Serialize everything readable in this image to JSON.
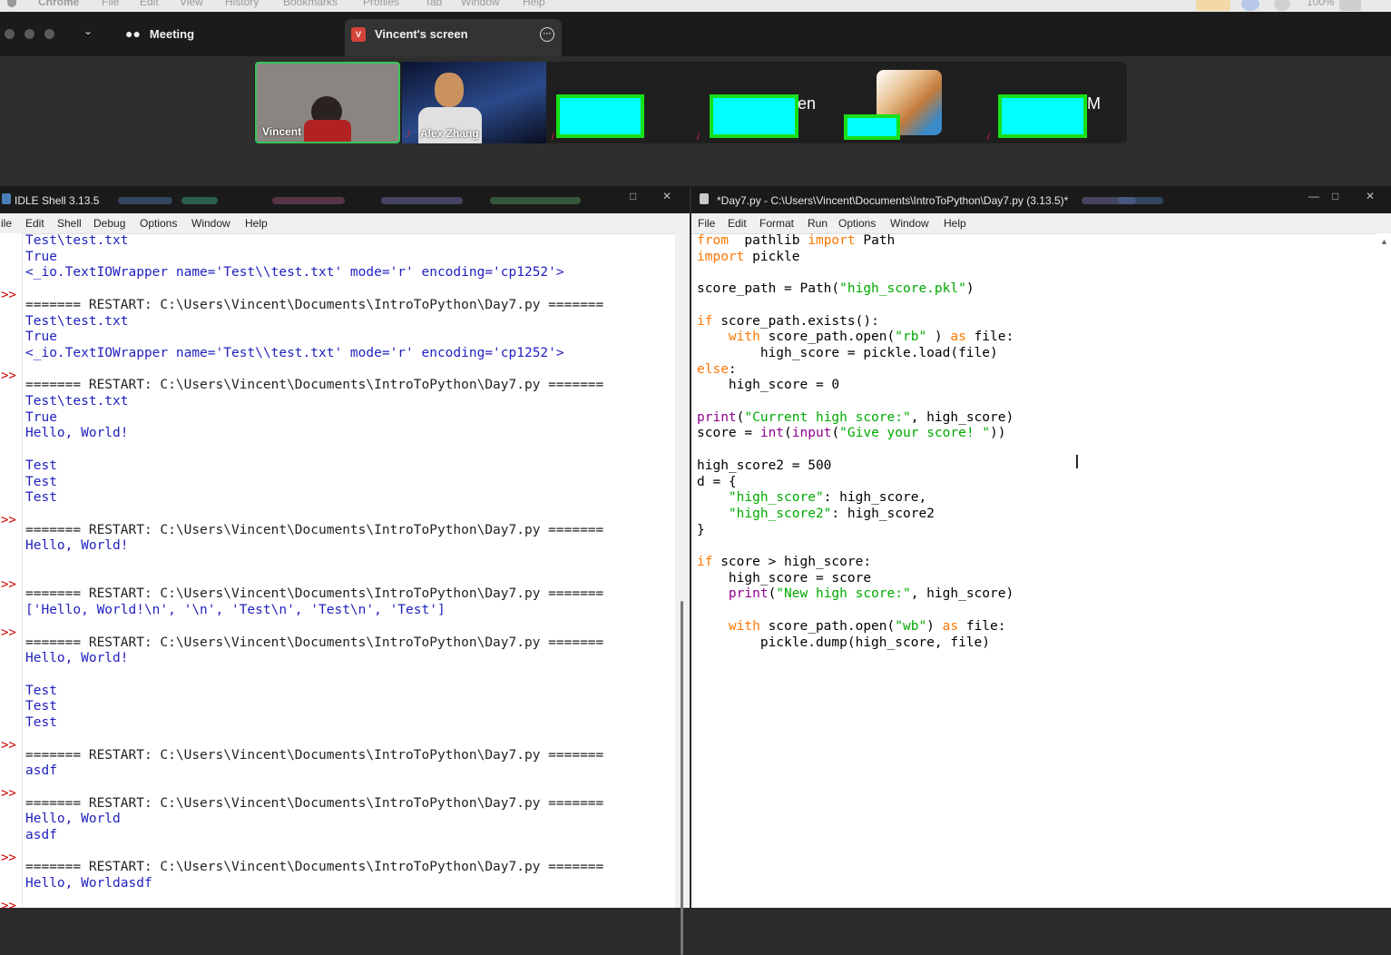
{
  "mac_menu": {
    "app": "Chrome",
    "items": [
      "File",
      "Edit",
      "View",
      "History",
      "Bookmarks",
      "Profiles",
      "Tab",
      "Window",
      "Help"
    ],
    "battery": "100%"
  },
  "zoom": {
    "meeting_label": "Meeting",
    "screen_tab_label": "Vincent's screen",
    "screen_tab_badge": "V",
    "participants": [
      {
        "name": "Vincent"
      },
      {
        "name": "Alex Zhang"
      }
    ],
    "name_fragments": [
      "en",
      "M"
    ]
  },
  "shell": {
    "title": "IDLE Shell 3.13.5",
    "menu": [
      "ile",
      "Edit",
      "Shell",
      "Debug",
      "Options",
      "Window",
      "Help"
    ],
    "lines": [
      {
        "t": "Test\\test.txt",
        "c": "out"
      },
      {
        "t": "True",
        "c": "out"
      },
      {
        "t": "<_io.TextIOWrapper name='Test\\\\test.txt' mode='r' encoding='cp1252'>",
        "c": "out"
      },
      {
        "t": "",
        "c": "sys",
        "p": ">>"
      },
      {
        "t": "======= RESTART: C:\\Users\\Vincent\\Documents\\IntroToPython\\Day7.py =======",
        "c": "sys"
      },
      {
        "t": "Test\\test.txt",
        "c": "out"
      },
      {
        "t": "True",
        "c": "out"
      },
      {
        "t": "<_io.TextIOWrapper name='Test\\\\test.txt' mode='r' encoding='cp1252'>",
        "c": "out"
      },
      {
        "t": "",
        "c": "sys",
        "p": ">>"
      },
      {
        "t": "======= RESTART: C:\\Users\\Vincent\\Documents\\IntroToPython\\Day7.py =======",
        "c": "sys"
      },
      {
        "t": "Test\\test.txt",
        "c": "out"
      },
      {
        "t": "True",
        "c": "out"
      },
      {
        "t": "Hello, World!",
        "c": "out"
      },
      {
        "t": "",
        "c": "out"
      },
      {
        "t": "Test",
        "c": "out"
      },
      {
        "t": "Test",
        "c": "out"
      },
      {
        "t": "Test",
        "c": "out"
      },
      {
        "t": "",
        "c": "sys",
        "p": ">>"
      },
      {
        "t": "======= RESTART: C:\\Users\\Vincent\\Documents\\IntroToPython\\Day7.py =======",
        "c": "sys"
      },
      {
        "t": "Hello, World!",
        "c": "out"
      },
      {
        "t": "",
        "c": "out"
      },
      {
        "t": "",
        "c": "sys",
        "p": ">>"
      },
      {
        "t": "======= RESTART: C:\\Users\\Vincent\\Documents\\IntroToPython\\Day7.py =======",
        "c": "sys"
      },
      {
        "t": "['Hello, World!\\n', '\\n', 'Test\\n', 'Test\\n', 'Test']",
        "c": "out"
      },
      {
        "t": "",
        "c": "sys",
        "p": ">>"
      },
      {
        "t": "======= RESTART: C:\\Users\\Vincent\\Documents\\IntroToPython\\Day7.py =======",
        "c": "sys"
      },
      {
        "t": "Hello, World!",
        "c": "out"
      },
      {
        "t": "",
        "c": "out"
      },
      {
        "t": "Test",
        "c": "out"
      },
      {
        "t": "Test",
        "c": "out"
      },
      {
        "t": "Test",
        "c": "out"
      },
      {
        "t": "",
        "c": "sys",
        "p": ">>"
      },
      {
        "t": "======= RESTART: C:\\Users\\Vincent\\Documents\\IntroToPython\\Day7.py =======",
        "c": "sys"
      },
      {
        "t": "asdf",
        "c": "out"
      },
      {
        "t": "",
        "c": "sys",
        "p": ">>"
      },
      {
        "t": "======= RESTART: C:\\Users\\Vincent\\Documents\\IntroToPython\\Day7.py =======",
        "c": "sys"
      },
      {
        "t": "Hello, World",
        "c": "out"
      },
      {
        "t": "asdf",
        "c": "out"
      },
      {
        "t": "",
        "c": "sys",
        "p": ">>"
      },
      {
        "t": "======= RESTART: C:\\Users\\Vincent\\Documents\\IntroToPython\\Day7.py =======",
        "c": "sys"
      },
      {
        "t": "Hello, Worldasdf",
        "c": "out"
      },
      {
        "t": "",
        "c": "sys",
        "p": ">>"
      }
    ]
  },
  "editor": {
    "title": "*Day7.py - C:\\Users\\Vincent\\Documents\\IntroToPython\\Day7.py (3.13.5)*",
    "menu": [
      "File",
      "Edit",
      "Format",
      "Run",
      "Options",
      "Window",
      "Help"
    ],
    "code": [
      [
        [
          "kw",
          "from"
        ],
        [
          "",
          "  pathlib "
        ],
        [
          "kw",
          "import"
        ],
        [
          "",
          " Path"
        ]
      ],
      [
        [
          "kw",
          "import"
        ],
        [
          "",
          " pickle"
        ]
      ],
      [],
      [
        [
          "",
          "score_path = Path("
        ],
        [
          "st",
          "\"high_score.pkl\""
        ],
        [
          "",
          ")"
        ]
      ],
      [],
      [
        [
          "kw",
          "if"
        ],
        [
          "",
          " score_path.exists():"
        ]
      ],
      [
        [
          "",
          "    "
        ],
        [
          "kw",
          "with"
        ],
        [
          "",
          " score_path.open("
        ],
        [
          "st",
          "\"rb\""
        ],
        [
          "",
          " ) "
        ],
        [
          "kw",
          "as"
        ],
        [
          "",
          " file:"
        ]
      ],
      [
        [
          "",
          "        high_score = pickle.load(file)"
        ]
      ],
      [
        [
          "kw",
          "else"
        ],
        [
          "",
          ":"
        ]
      ],
      [
        [
          "",
          "    high_score = 0"
        ]
      ],
      [],
      [
        [
          "bi",
          "print"
        ],
        [
          "",
          "("
        ],
        [
          "st",
          "\"Current high score:\""
        ],
        [
          "",
          ", high_score)"
        ]
      ],
      [
        [
          "",
          "score = "
        ],
        [
          "bi",
          "int"
        ],
        [
          "",
          "("
        ],
        [
          "bi",
          "input"
        ],
        [
          "",
          "("
        ],
        [
          "st",
          "\"Give your score! \""
        ],
        [
          "",
          "))"
        ]
      ],
      [],
      [
        [
          "",
          "high_score2 = 500"
        ]
      ],
      [
        [
          "",
          "d = {"
        ]
      ],
      [
        [
          "",
          "    "
        ],
        [
          "st",
          "\"high_score\""
        ],
        [
          "",
          ": high_score,"
        ]
      ],
      [
        [
          "",
          "    "
        ],
        [
          "st",
          "\"high_score2\""
        ],
        [
          "",
          ": high_score2"
        ]
      ],
      [
        [
          "",
          "}"
        ]
      ],
      [],
      [
        [
          "kw",
          "if"
        ],
        [
          "",
          " score > high_score:"
        ]
      ],
      [
        [
          "",
          "    high_score = score"
        ]
      ],
      [
        [
          "",
          "    "
        ],
        [
          "bi",
          "print"
        ],
        [
          "",
          "("
        ],
        [
          "st",
          "\"New high score:\""
        ],
        [
          "",
          ", high_score)"
        ]
      ],
      [],
      [
        [
          "",
          "    "
        ],
        [
          "kw",
          "with"
        ],
        [
          "",
          " score_path.open("
        ],
        [
          "st",
          "\"wb\""
        ],
        [
          "",
          ") "
        ],
        [
          "kw",
          "as"
        ],
        [
          "",
          " file:"
        ]
      ],
      [
        [
          "",
          "        pickle.dump(high_score, file)"
        ]
      ]
    ]
  },
  "colors": {
    "keyword": "#ff7700",
    "string": "#00aa00",
    "builtin": "#900090",
    "shell_output": "#1f1fbf",
    "prompt": "#cc0000",
    "redaction_fill": "#00ffff",
    "redaction_border": "#18e018"
  }
}
